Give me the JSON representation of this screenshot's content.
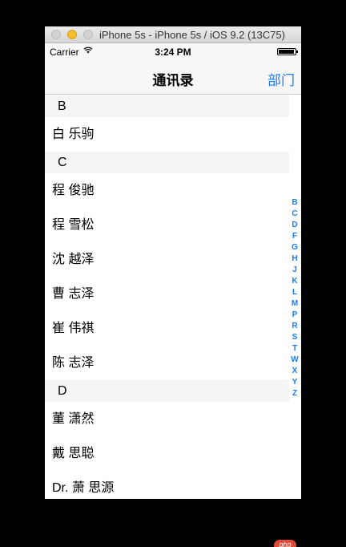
{
  "window": {
    "title": "iPhone 5s - iPhone 5s / iOS 9.2 (13C75)"
  },
  "status_bar": {
    "carrier": "Carrier",
    "time": "3:24 PM"
  },
  "nav": {
    "title": "通讯录",
    "right_button": "部门"
  },
  "sections": [
    {
      "header": "B",
      "rows": [
        "白 乐驹"
      ]
    },
    {
      "header": "C",
      "rows": [
        "程 俊驰",
        "程 雪松",
        "沈 越泽",
        "曹 志泽",
        "崔 伟祺",
        "陈 志泽"
      ]
    },
    {
      "header": "D",
      "rows": [
        "董 潇然",
        "戴 思聪",
        "Dr. 萧 思源"
      ]
    }
  ],
  "index": [
    "B",
    "C",
    "D",
    "F",
    "G",
    "H",
    "J",
    "K",
    "L",
    "M",
    "P",
    "R",
    "S",
    "T",
    "W",
    "X",
    "Y",
    "Z"
  ],
  "watermark": "php"
}
